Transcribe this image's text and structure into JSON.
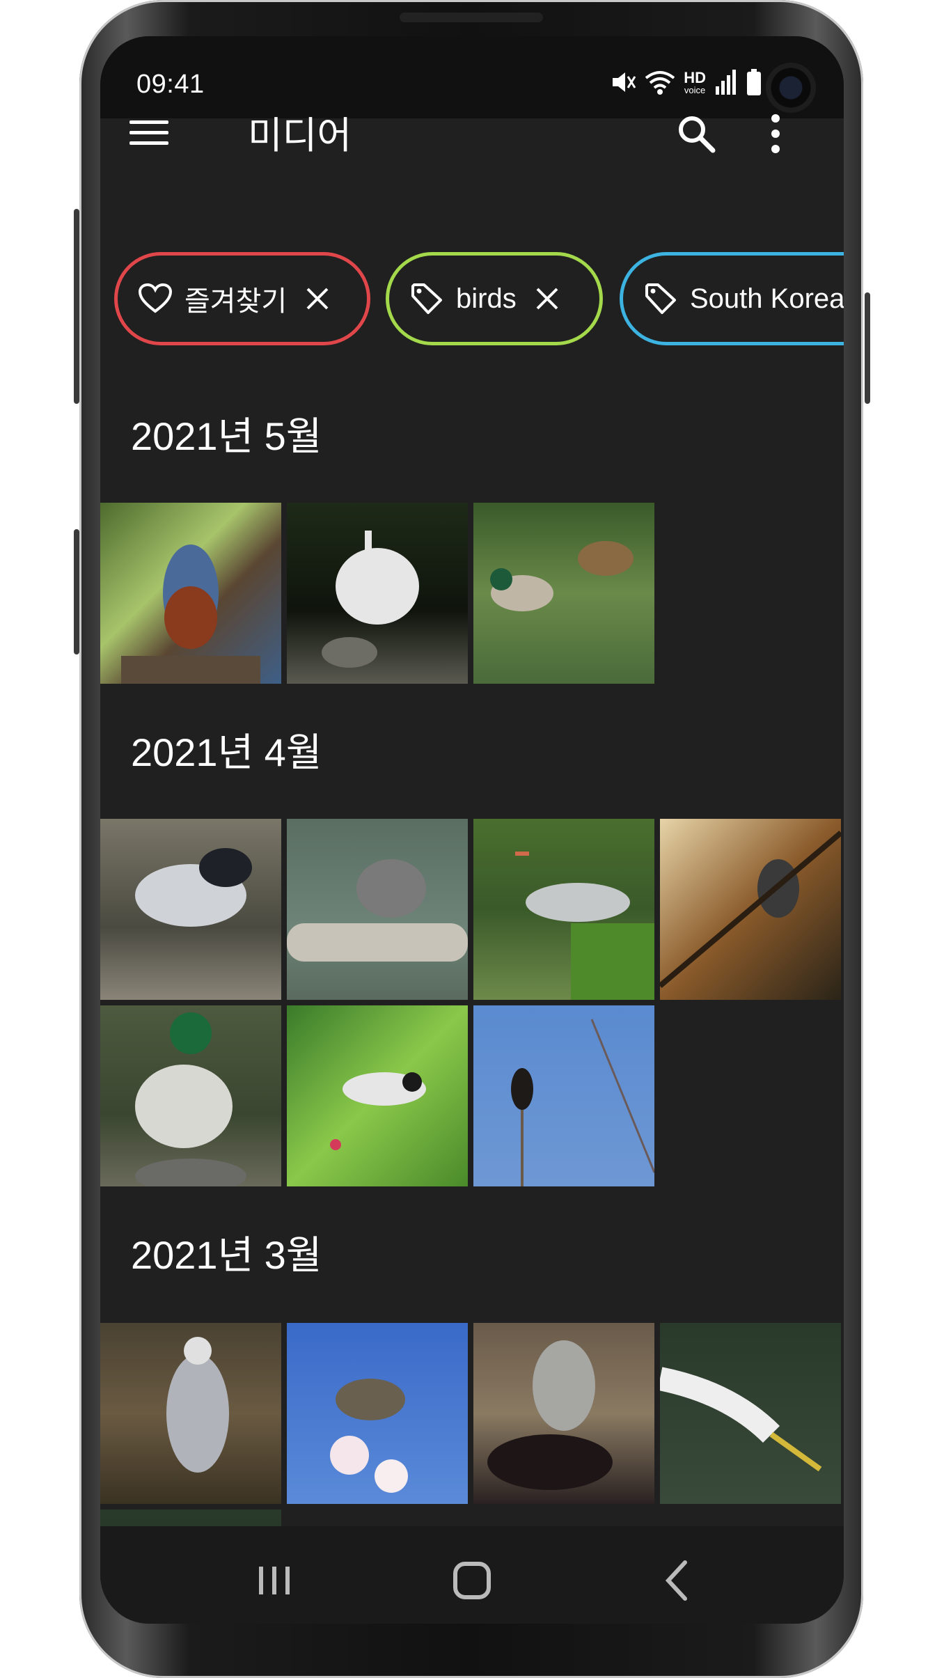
{
  "status_bar": {
    "time": "09:41",
    "icons": [
      "mute-icon",
      "wifi-icon",
      "hd-voice-icon",
      "signal-icon",
      "battery-icon"
    ],
    "hd_top": "HD",
    "hd_bottom": "voice"
  },
  "app_bar": {
    "title": "미디어",
    "icons": [
      "menu-icon",
      "search-icon",
      "more-vert-icon"
    ]
  },
  "filters": [
    {
      "label": "즐겨찾기",
      "icon": "heart-icon",
      "color": "#e0464a",
      "removable": true
    },
    {
      "label": "birds",
      "icon": "tag-icon",
      "color": "#a3d94a",
      "removable": true
    },
    {
      "label": "South Korea",
      "icon": "tag-icon",
      "color": "#3cb3e0",
      "removable": true
    }
  ],
  "sections": [
    {
      "label": "2021년 5월",
      "photos": [
        "blue rock thrush",
        "great egret",
        "mallard ducks"
      ]
    },
    {
      "label": "2021년 4월",
      "photos": [
        "night heron",
        "bulbul on branch",
        "grey heron",
        "bird in branches",
        "mallard drake",
        "tit on blossom",
        "bird on twig"
      ]
    },
    {
      "label": "2021년 3월",
      "photos": [
        "grey heron",
        "bulbul in blossom",
        "goshawk",
        "egret head",
        "egret fishing"
      ]
    }
  ],
  "colors": {
    "background": "#202020",
    "status_bar": "#111111",
    "text": "#ffffff"
  },
  "nav_bar": {
    "icons": [
      "recents-icon",
      "home-icon",
      "back-icon"
    ]
  }
}
